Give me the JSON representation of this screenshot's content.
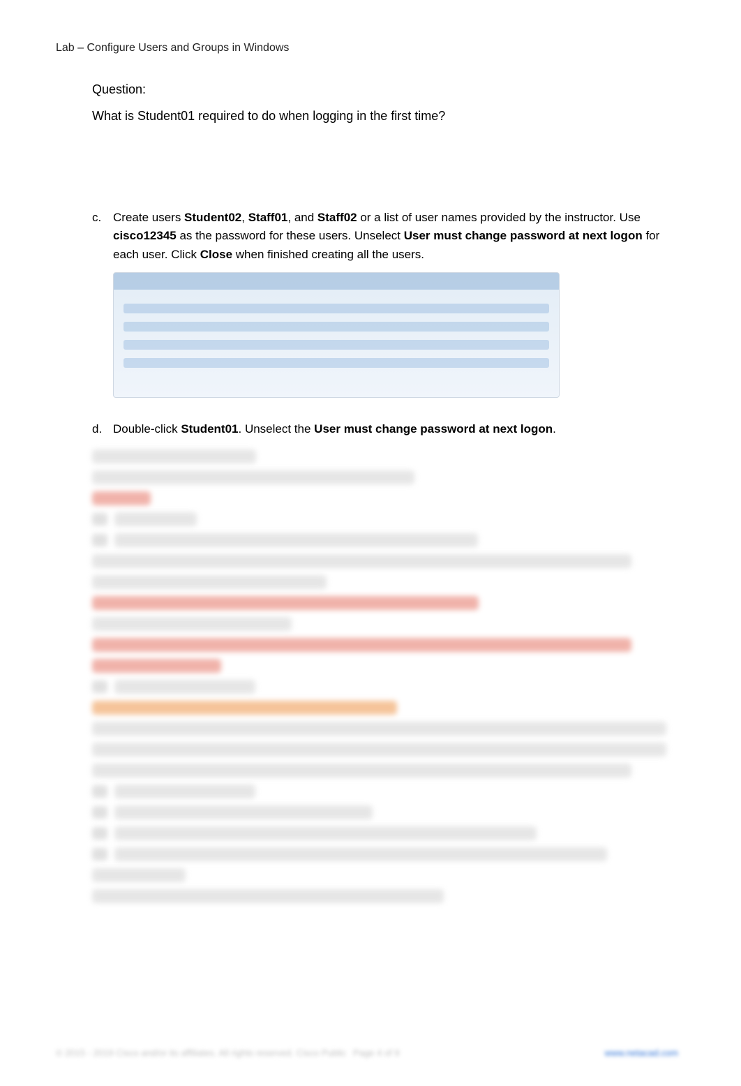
{
  "header": {
    "title": "Lab – Configure Users and Groups in Windows"
  },
  "question_block": {
    "label": "Question:",
    "text": "What is Student01 required to do when logging in the first time?"
  },
  "steps": [
    {
      "letter": "c.",
      "segments": [
        {
          "t": "Create users ",
          "b": false
        },
        {
          "t": "Student02",
          "b": true
        },
        {
          "t": ", ",
          "b": false
        },
        {
          "t": "Staff01",
          "b": true
        },
        {
          "t": ", and ",
          "b": false
        },
        {
          "t": "Staff02",
          "b": true
        },
        {
          "t": " or a list of user names provided by the instructor. Use ",
          "b": false
        },
        {
          "t": "cisco12345",
          "b": true
        },
        {
          "t": " as the password for these users. Unselect ",
          "b": false
        },
        {
          "t": "User must change password at next logon",
          "b": true
        },
        {
          "t": " for each user. Click ",
          "b": false
        },
        {
          "t": "Close",
          "b": true
        },
        {
          "t": " when finished creating all the users.",
          "b": false
        }
      ],
      "has_image": true
    },
    {
      "letter": "d.",
      "segments": [
        {
          "t": "Double-click ",
          "b": false
        },
        {
          "t": "Student01",
          "b": true
        },
        {
          "t": ". Unselect the ",
          "b": false
        },
        {
          "t": "User must change password at next logon",
          "b": true
        },
        {
          "t": ".",
          "b": false
        }
      ],
      "has_image": false
    }
  ],
  "footer": {
    "left": "© 2015 - 2019 Cisco and/or its affiliates. All rights reserved. Cisco Public",
    "mid": "Page 4 of 9",
    "right_text": "www.netacad.com",
    "right_href": "#"
  }
}
